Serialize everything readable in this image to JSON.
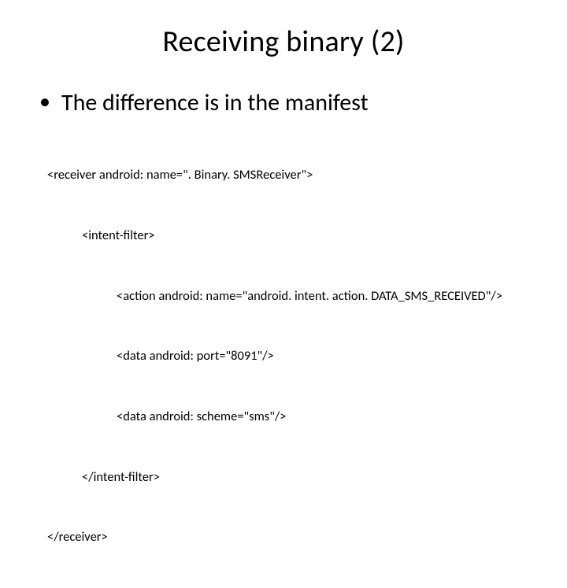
{
  "title": "Receiving binary (2)",
  "bullet": "The difference is in the manifest",
  "code": {
    "l1": "<receiver android: name=\". Binary. SMSReceiver\">",
    "l2": "<intent-filter>",
    "l3": "<action android: name=\"android. intent. action. DATA_SMS_RECEIVED\"/>",
    "l4": "<data android: port=\"8091\"/>",
    "l5": "<data android: scheme=\"sms\"/>",
    "l6": "</intent-filter>",
    "l7": "</receiver>"
  }
}
